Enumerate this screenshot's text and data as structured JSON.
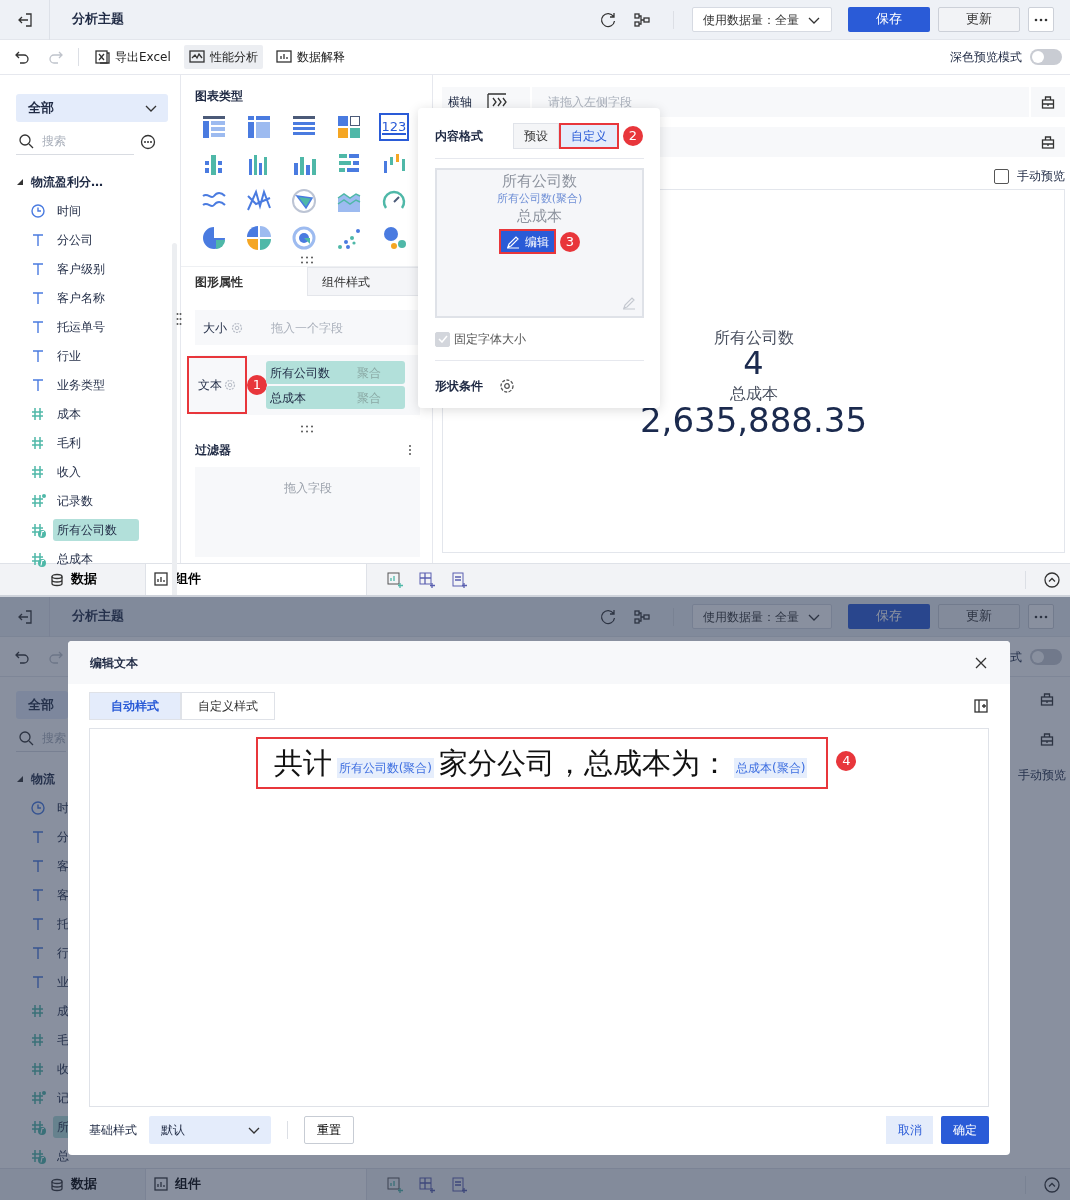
{
  "top": {
    "header": {
      "title": "分析主题",
      "data_amount": "使用数据量：全量",
      "save": "保存",
      "update": "更新"
    },
    "toolbar": {
      "history": [
        {
          "kind": "undo",
          "disabled": false
        },
        {
          "kind": "redo",
          "disabled": true
        }
      ],
      "items": [
        {
          "kind": "excel",
          "label": "导出Excel",
          "selected": false
        },
        {
          "kind": "perf",
          "label": "性能分析",
          "selected": true
        },
        {
          "kind": "explain",
          "label": "数据解释",
          "selected": false
        }
      ],
      "dark_mode": {
        "label": "深色预览模式",
        "on": false
      }
    },
    "sidebar": {
      "dropdown": "全部",
      "search_placeholder": "搜索",
      "tree": [
        {
          "label": "物流盈利分…",
          "expanded": true,
          "children": [
            {
              "label": "时间",
              "kind": "date",
              "selected": false
            },
            {
              "label": "分公司",
              "kind": "text",
              "selected": false
            },
            {
              "label": "客户级别",
              "kind": "text",
              "selected": false
            },
            {
              "label": "客户名称",
              "kind": "text",
              "selected": false
            },
            {
              "label": "托运单号",
              "kind": "text",
              "selected": false
            },
            {
              "label": "行业",
              "kind": "text",
              "selected": false
            },
            {
              "label": "业务类型",
              "kind": "text",
              "selected": false
            },
            {
              "label": "成本",
              "kind": "number",
              "selected": false
            },
            {
              "label": "毛利",
              "kind": "number",
              "selected": false
            },
            {
              "label": "收入",
              "kind": "number",
              "selected": false
            },
            {
              "label": "记录数",
              "kind": "count",
              "selected": false
            },
            {
              "label": "所有公司数",
              "kind": "calc",
              "selected": true
            },
            {
              "label": "总成本",
              "kind": "calc",
              "selected": false
            }
          ]
        }
      ]
    },
    "chart_types": {
      "title": "图表类型",
      "items": [
        {
          "kind": "table",
          "selected": false
        },
        {
          "kind": "cross-table",
          "selected": false
        },
        {
          "kind": "detail-table",
          "selected": false
        },
        {
          "kind": "treemap",
          "selected": false
        },
        {
          "kind": "kpi",
          "text": "123",
          "selected": true
        },
        {
          "kind": "grouped-bar",
          "selected": false
        },
        {
          "kind": "multi-bar",
          "selected": false
        },
        {
          "kind": "bar",
          "selected": false
        },
        {
          "kind": "stacked-bar",
          "selected": false
        },
        {
          "kind": "range-bar",
          "selected": false
        },
        {
          "kind": "line",
          "selected": false
        },
        {
          "kind": "multi-line",
          "selected": false
        },
        {
          "kind": "radar",
          "selected": false
        },
        {
          "kind": "area",
          "selected": false
        },
        {
          "kind": "gauge",
          "selected": false
        },
        {
          "kind": "pie",
          "selected": false
        },
        {
          "kind": "multi-pie",
          "selected": false
        },
        {
          "kind": "ring",
          "selected": false
        },
        {
          "kind": "scatter",
          "selected": false
        },
        {
          "kind": "bubble",
          "selected": false
        }
      ]
    },
    "attributes": {
      "tabs": [
        {
          "label": "图形属性",
          "selected": true
        },
        {
          "label": "组件样式",
          "selected": false
        }
      ],
      "size": {
        "label": "大小",
        "placeholder": "拖入一个字段"
      },
      "text": {
        "label": "文本",
        "callout": "1",
        "pills": [
          {
            "name": "所有公司数",
            "agg": "聚合"
          },
          {
            "name": "总成本",
            "agg": "聚合"
          }
        ]
      },
      "filter": {
        "title": "过滤器",
        "placeholder": "拖入字段"
      }
    },
    "canvas": {
      "axis": {
        "label": "横轴",
        "placeholder": "请拖入左侧字段"
      },
      "manual_preview": {
        "label": "手动预览",
        "checked": false
      },
      "kpi": [
        {
          "label": "所有公司数",
          "value": "4"
        },
        {
          "label": "总成本",
          "value": "2,635,888.35"
        }
      ]
    },
    "popup": {
      "title": "内容格式",
      "options": [
        {
          "label": "预设",
          "selected": false
        },
        {
          "label": "自定义",
          "selected": true
        }
      ],
      "callout": "2",
      "preview": [
        "所有公司数",
        "所有公司数(聚合)",
        "总成本"
      ],
      "edit_button": "编辑",
      "edit_callout": "3",
      "fixed_font": {
        "label": "固定字体大小",
        "checked": true,
        "disabled": true
      },
      "shape_condition": "形状条件"
    },
    "bottom_tabs": [
      {
        "kind": "data",
        "label": "数据",
        "selected": false
      },
      {
        "kind": "component",
        "label": "组件",
        "selected": true
      }
    ]
  },
  "bottom": {
    "header": {
      "title": "分析主题",
      "data_amount": "使用数据量：全量",
      "save": "保存",
      "update": "更新"
    },
    "toolbar": {
      "history": [
        {
          "kind": "undo",
          "disabled": false
        },
        {
          "kind": "redo",
          "disabled": true
        }
      ],
      "dark_mode": {
        "label": "式",
        "on": false
      }
    },
    "sidebar": {
      "dropdown": "全部",
      "search_placeholder": "搜索",
      "tree": [
        {
          "label": "物流",
          "expanded": true,
          "children": [
            {
              "label": "时",
              "kind": "date",
              "selected": false
            },
            {
              "label": "分",
              "kind": "text",
              "selected": false
            },
            {
              "label": "客",
              "kind": "text",
              "selected": false
            },
            {
              "label": "客",
              "kind": "text",
              "selected": false
            },
            {
              "label": "托",
              "kind": "text",
              "selected": false
            },
            {
              "label": "行",
              "kind": "text",
              "selected": false
            },
            {
              "label": "业",
              "kind": "text",
              "selected": false
            },
            {
              "label": "成",
              "kind": "number",
              "selected": false
            },
            {
              "label": "毛",
              "kind": "number",
              "selected": false
            },
            {
              "label": "收",
              "kind": "number",
              "selected": false
            },
            {
              "label": "记",
              "kind": "count",
              "selected": false
            },
            {
              "label": "所",
              "kind": "calc",
              "selected": true
            },
            {
              "label": "总",
              "kind": "calc",
              "selected": false
            }
          ]
        }
      ]
    },
    "manual_preview": "手动预览",
    "bottom_tabs": [
      {
        "kind": "data",
        "label": "数据",
        "selected": false
      },
      {
        "kind": "component",
        "label": "组件",
        "selected": true
      }
    ],
    "dialog": {
      "title": "编辑文本",
      "tabs": [
        {
          "label": "自动样式",
          "selected": true
        },
        {
          "label": "自定义样式",
          "selected": false
        }
      ],
      "content": [
        {
          "kind": "text",
          "text": "共计"
        },
        {
          "kind": "field",
          "text": "所有公司数(聚合)"
        },
        {
          "kind": "text",
          "text": "家分公司，总成本为："
        },
        {
          "kind": "field",
          "text": "总成本(聚合)"
        }
      ],
      "callout": "4",
      "base_style": {
        "label": "基础样式",
        "value": "默认"
      },
      "reset": "重置",
      "cancel": "取消",
      "ok": "确定"
    }
  }
}
